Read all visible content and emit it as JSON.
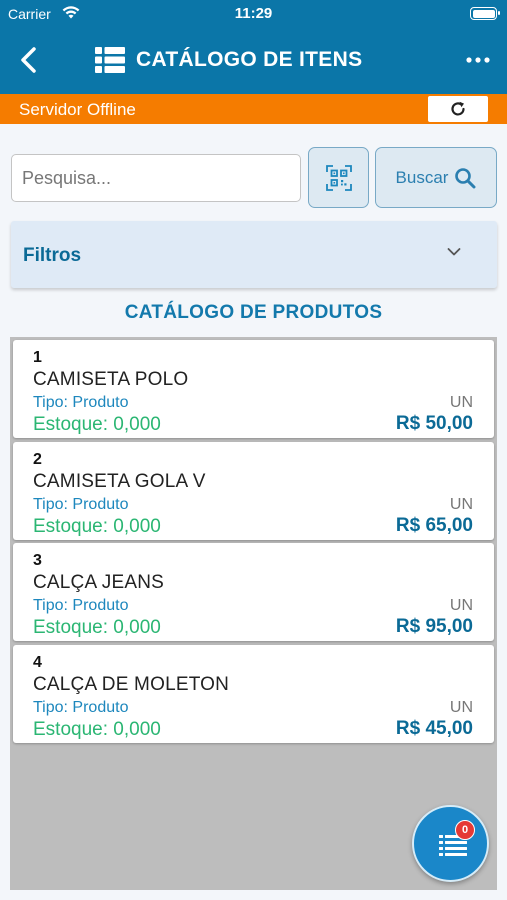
{
  "status_bar": {
    "carrier": "Carrier",
    "time": "11:29"
  },
  "header": {
    "title": "CATÁLOGO DE ITENS",
    "back_icon": "chevron-left-icon",
    "list_icon": "list-icon",
    "more_icon": "ellipsis-icon"
  },
  "offline": {
    "text": "Servidor Offline",
    "refresh_icon": "refresh-icon"
  },
  "search": {
    "placeholder": "Pesquisa...",
    "value": "",
    "qr_icon": "qr-code-scan-icon",
    "button_label": "Buscar",
    "button_icon": "search-icon"
  },
  "filters": {
    "label": "Filtros",
    "icon": "chevron-down-icon",
    "expanded": false
  },
  "section": {
    "title": "CATÁLOGO DE PRODUTOS"
  },
  "products": [
    {
      "number": "1",
      "name": "CAMISETA POLO",
      "tipo": "Tipo: Produto",
      "unit": "UN",
      "estoque": "Estoque: 0,000",
      "price": "R$ 50,00"
    },
    {
      "number": "2",
      "name": "CAMISETA GOLA V",
      "tipo": "Tipo: Produto",
      "unit": "UN",
      "estoque": "Estoque: 0,000",
      "price": "R$ 65,00"
    },
    {
      "number": "3",
      "name": "CALÇA JEANS",
      "tipo": "Tipo: Produto",
      "unit": "UN",
      "estoque": "Estoque: 0,000",
      "price": "R$ 95,00"
    },
    {
      "number": "4",
      "name": "CALÇA DE MOLETON",
      "tipo": "Tipo: Produto",
      "unit": "UN",
      "estoque": "Estoque: 0,000",
      "price": "R$ 45,00"
    }
  ],
  "fab": {
    "icon": "cart-list-icon",
    "badge": "0"
  },
  "colors": {
    "header": "#0b76a8",
    "offline": "#f57c00",
    "accent": "#1379ac",
    "stock": "#2bb673",
    "badge": "#e53935"
  }
}
